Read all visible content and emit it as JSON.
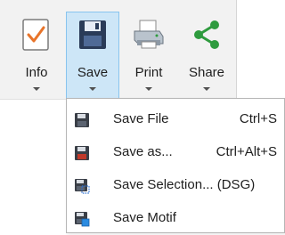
{
  "ribbon": {
    "buttons": [
      {
        "id": "info",
        "label": "Info",
        "icon": "info-checkbox-icon"
      },
      {
        "id": "save",
        "label": "Save",
        "icon": "floppy-disk-icon",
        "active": true
      },
      {
        "id": "print",
        "label": "Print",
        "icon": "printer-icon"
      },
      {
        "id": "share",
        "label": "Share",
        "icon": "share-icon"
      }
    ]
  },
  "save_menu": {
    "items": [
      {
        "label": "Save File",
        "shortcut": "Ctrl+S",
        "icon": "floppy-disk-dark-icon"
      },
      {
        "label": "Save as...",
        "shortcut": "Ctrl+Alt+S",
        "icon": "floppy-disk-red-icon"
      },
      {
        "label": "Save Selection... (DSG)",
        "shortcut": "",
        "icon": "floppy-disk-selection-icon"
      },
      {
        "label": "Save Motif",
        "shortcut": "",
        "icon": "floppy-disk-motif-icon"
      }
    ]
  },
  "colors": {
    "active_bg": "#cde6f7",
    "active_border": "#88c4ee",
    "share_green": "#2e9b3e",
    "info_orange": "#e8742a"
  }
}
